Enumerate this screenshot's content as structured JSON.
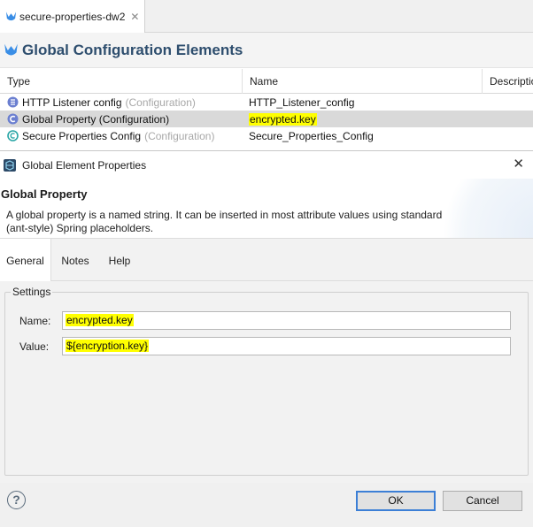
{
  "editor_tab": {
    "label": "secure-properties-dw2",
    "close": "✕"
  },
  "global_config": {
    "title": "Global Configuration Elements",
    "columns": {
      "type": "Type",
      "name": "Name",
      "description": "Description"
    },
    "rows": [
      {
        "type": "HTTP Listener config",
        "kind": "(Configuration)",
        "name": "HTTP_Listener_config",
        "icon": "http-listener-icon"
      },
      {
        "type": "Global Property (Configuration)",
        "kind": "",
        "name": "encrypted.key",
        "icon": "global-property-icon"
      },
      {
        "type": "Secure Properties Config",
        "kind": "(Configuration)",
        "name": "Secure_Properties_Config",
        "icon": "secure-properties-icon"
      }
    ]
  },
  "dialog": {
    "title": "Global Element Properties",
    "close": "✕",
    "heading": "Global Property",
    "description": "A global property is a named string. It can be inserted in most attribute values using standard (ant-style) Spring placeholders.",
    "tabs": [
      "General",
      "Notes",
      "Help"
    ],
    "settings": {
      "legend": "Settings",
      "name_label": "Name:",
      "name_value": "encrypted.key",
      "value_label": "Value:",
      "value_value": "${encryption.key}"
    },
    "help": "?",
    "ok": "OK",
    "cancel": "Cancel"
  },
  "colors": {
    "highlight": "#ffff00",
    "title_blue": "#2e4e6e",
    "ok_border": "#3c7fd6",
    "selected_row": "#d9d9d9"
  }
}
